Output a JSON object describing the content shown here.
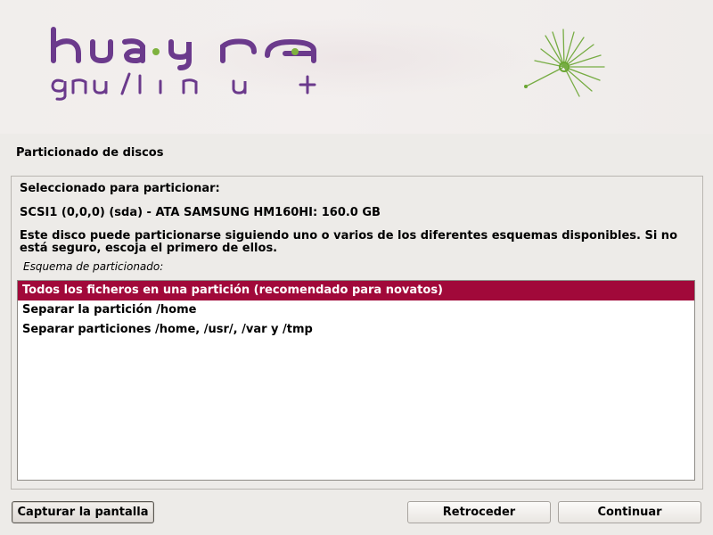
{
  "brand": {
    "logo_text": "huayra",
    "logo_subtext": "gnu/linux",
    "logo_color": "#6b3a8c",
    "accent_dot_color": "#7fb23f"
  },
  "page": {
    "title": "Particionado de discos"
  },
  "content": {
    "selected_label": "Seleccionado para particionar:",
    "disk": "SCSI1 (0,0,0) (sda) - ATA SAMSUNG HM160HI: 160.0 GB",
    "description": "Este disco puede particionarse siguiendo uno o varios de los diferentes esquemas disponibles. Si no está seguro, escoja el primero de ellos.",
    "schema_label": "Esquema de particionado:"
  },
  "list": {
    "items": [
      {
        "label": "Todos los ficheros en una partición (recomendado para novatos)",
        "selected": true
      },
      {
        "label": "Separar la partición /home",
        "selected": false
      },
      {
        "label": "Separar particiones /home, /usr/, /var y /tmp",
        "selected": false
      }
    ],
    "selection_color": "#a1093a"
  },
  "buttons": {
    "screenshot": "Capturar la pantalla",
    "back": "Retroceder",
    "continue": "Continuar"
  }
}
